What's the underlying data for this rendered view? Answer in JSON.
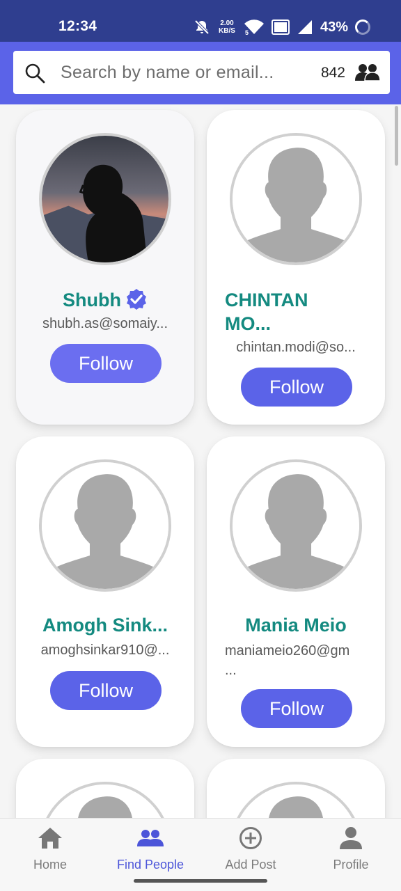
{
  "status_bar": {
    "time": "12:34",
    "speed_value": "2.00",
    "speed_unit": "KB/S",
    "battery": "43%",
    "icons": [
      "bell-off-icon",
      "wifi-icon",
      "vowifi-icon",
      "signal-icon",
      "battery-icon"
    ]
  },
  "search": {
    "placeholder": "Search by name or email...",
    "count": "842",
    "icon": "search-icon",
    "count_icon": "group-icon"
  },
  "users": [
    {
      "name": "Shubh",
      "verified": true,
      "email": "shubh.as@somaiy...",
      "follow_label": "Follow",
      "avatar": "photo"
    },
    {
      "name": "CHINTAN MO...",
      "name_line1": "CHINTAN",
      "name_line2": "MO...",
      "verified": false,
      "email": "chintan.modi@so...",
      "follow_label": "Follow",
      "avatar": "default"
    },
    {
      "name": "Amogh Sink...",
      "verified": false,
      "email": "amoghsinkar910@...",
      "follow_label": "Follow",
      "avatar": "default"
    },
    {
      "name": "Mania Meio",
      "verified": false,
      "email": "maniameio260@gm ...",
      "email_line1": "maniameio260@gm",
      "email_line2": "...",
      "follow_label": "Follow",
      "avatar": "default"
    }
  ],
  "nav": [
    {
      "label": "Home",
      "icon": "home-icon",
      "active": false
    },
    {
      "label": "Find People",
      "icon": "group-icon",
      "active": true
    },
    {
      "label": "Add Post",
      "icon": "add-circle-icon",
      "active": false
    },
    {
      "label": "Profile",
      "icon": "person-icon",
      "active": false
    }
  ],
  "colors": {
    "status_bar": "#2f3e8f",
    "accent": "#5b63e8",
    "name_text": "#148a80",
    "nav_active": "#4c55d9"
  }
}
